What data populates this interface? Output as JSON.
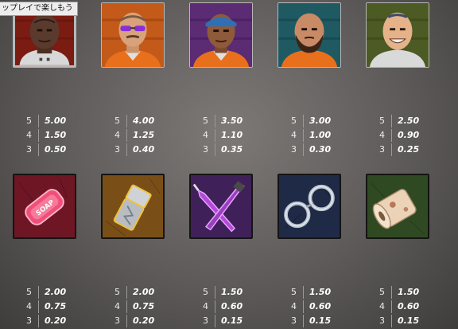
{
  "tooltip": "ップレイで楽しもう",
  "row1": [
    {
      "name": "Bald tattooed prisoner",
      "pays": [
        {
          "n": "5",
          "v": "5.00"
        },
        {
          "n": "4",
          "v": "1.50"
        },
        {
          "n": "3",
          "v": "0.50"
        }
      ],
      "bg": "#7a1c12"
    },
    {
      "name": "Purple sunglasses prisoner",
      "pays": [
        {
          "n": "5",
          "v": "4.00"
        },
        {
          "n": "4",
          "v": "1.25"
        },
        {
          "n": "3",
          "v": "0.40"
        }
      ],
      "bg": "#c35a1a"
    },
    {
      "name": "Bandana prisoner",
      "pays": [
        {
          "n": "5",
          "v": "3.50"
        },
        {
          "n": "4",
          "v": "1.10"
        },
        {
          "n": "3",
          "v": "0.35"
        }
      ],
      "bg": "#5b2b74"
    },
    {
      "name": "Bearded prisoner",
      "pays": [
        {
          "n": "5",
          "v": "3.00"
        },
        {
          "n": "4",
          "v": "1.00"
        },
        {
          "n": "3",
          "v": "0.30"
        }
      ],
      "bg": "#1f5a63"
    },
    {
      "name": "Smiling tattooed prisoner",
      "pays": [
        {
          "n": "5",
          "v": "2.50"
        },
        {
          "n": "4",
          "v": "0.90"
        },
        {
          "n": "3",
          "v": "0.25"
        }
      ],
      "bg": "#4c5a23"
    }
  ],
  "row2": [
    {
      "name": "Soap",
      "label": "SOAP",
      "pays": [
        {
          "n": "5",
          "v": "2.00"
        },
        {
          "n": "4",
          "v": "0.75"
        },
        {
          "n": "3",
          "v": "0.20"
        }
      ],
      "bg": "#6e1624"
    },
    {
      "name": "Lighter",
      "pays": [
        {
          "n": "5",
          "v": "2.00"
        },
        {
          "n": "4",
          "v": "0.75"
        },
        {
          "n": "3",
          "v": "0.20"
        }
      ],
      "bg": "#7a4f17"
    },
    {
      "name": "Shiv and screwdriver",
      "pays": [
        {
          "n": "5",
          "v": "1.50"
        },
        {
          "n": "4",
          "v": "0.60"
        },
        {
          "n": "3",
          "v": "0.15"
        }
      ],
      "bg": "#3f2058"
    },
    {
      "name": "Handcuffs",
      "pays": [
        {
          "n": "5",
          "v": "1.50"
        },
        {
          "n": "4",
          "v": "0.60"
        },
        {
          "n": "3",
          "v": "0.15"
        }
      ],
      "bg": "#1e2a46"
    },
    {
      "name": "Toilet paper",
      "pays": [
        {
          "n": "5",
          "v": "1.50"
        },
        {
          "n": "4",
          "v": "0.60"
        },
        {
          "n": "3",
          "v": "0.15"
        }
      ],
      "bg": "#2f4a22"
    }
  ]
}
